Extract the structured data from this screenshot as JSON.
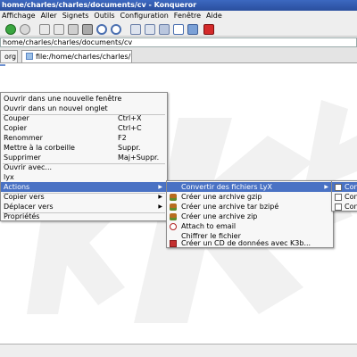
{
  "window": {
    "title": "home/charles/charles/documents/cv - Konqueror"
  },
  "menubar": [
    "Affichage",
    "Aller",
    "Signets",
    "Outils",
    "Configuration",
    "Fenêtre",
    "Aide"
  ],
  "location": {
    "value": "home/charles/charles/documents/cv"
  },
  "tabs": [
    {
      "label": "org"
    },
    {
      "label": "file:/home/charles/charles/..."
    }
  ],
  "context_menu": {
    "items": [
      {
        "label": "Ouvrir dans une nouvelle fenêtre",
        "shortcut": ""
      },
      {
        "label": "Ouvrir dans un nouvel onglet",
        "shortcut": ""
      },
      {
        "label": "Couper",
        "shortcut": "Ctrl+X"
      },
      {
        "label": "Copier",
        "shortcut": "Ctrl+C"
      },
      {
        "label": "Renommer",
        "shortcut": "F2"
      },
      {
        "label": "Mettre à la corbeille",
        "shortcut": "Suppr."
      },
      {
        "label": "Supprimer",
        "shortcut": "Maj+Suppr."
      },
      {
        "label": "Ouvrir avec...",
        "shortcut": ""
      },
      {
        "label": "lyx",
        "shortcut": ""
      },
      {
        "label": "Actions",
        "shortcut": ""
      },
      {
        "label": "Copier vers",
        "shortcut": ""
      },
      {
        "label": "Déplacer vers",
        "shortcut": ""
      },
      {
        "label": "Propriétés",
        "shortcut": ""
      }
    ]
  },
  "actions_submenu": {
    "items": [
      {
        "label": "Convertir des fichiers LyX",
        "icon": "none"
      },
      {
        "label": "Créer une archive gzip",
        "icon": "archive-icon"
      },
      {
        "label": "Créer une archive tar bzipé",
        "icon": "archive-icon"
      },
      {
        "label": "Créer une archive zip",
        "icon": "archive-icon"
      },
      {
        "label": "Attach to email",
        "icon": "mail-icon"
      },
      {
        "label": "Chiffrer le fichier",
        "icon": "none"
      },
      {
        "label": "Créer un CD de données avec K3b...",
        "icon": "k3b-icon"
      }
    ]
  },
  "convert_submenu": {
    "items": [
      {
        "label": "Con"
      },
      {
        "label": "Con"
      },
      {
        "label": "Con"
      }
    ]
  },
  "colors": {
    "titlebar": "#2a4f9e",
    "highlight": "#4a72c4",
    "watermark": "#f1f1f1"
  }
}
